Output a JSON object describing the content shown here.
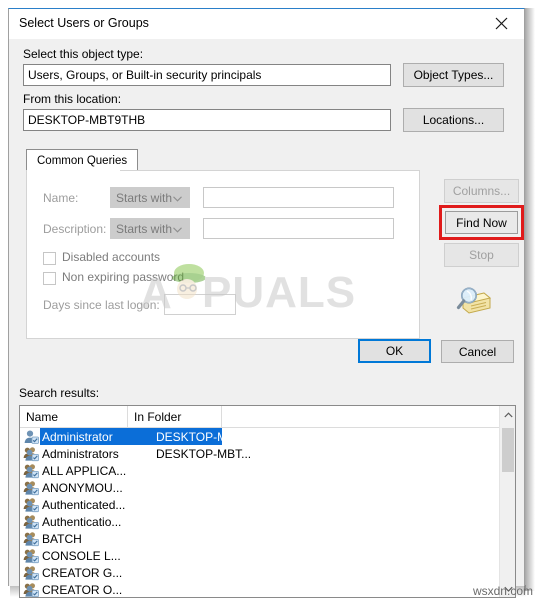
{
  "window": {
    "title": "Select Users or Groups",
    "close_icon": "close-icon"
  },
  "object_type": {
    "label": "Select this object type:",
    "value": "Users, Groups, or Built-in security principals",
    "button": "Object Types..."
  },
  "location": {
    "label": "From this location:",
    "value": "DESKTOP-MBT9THB",
    "button": "Locations..."
  },
  "tabs": [
    {
      "label": "Common Queries",
      "active": true
    }
  ],
  "query": {
    "name_label": "Name:",
    "name_operator": "Starts with",
    "name_value": "",
    "description_label": "Description:",
    "description_operator": "Starts with",
    "description_value": "",
    "disabled_accounts_label": "Disabled accounts",
    "disabled_accounts_checked": false,
    "non_expiring_password_label": "Non expiring password",
    "non_expiring_password_checked": false,
    "days_since_label": "Days since last logon:",
    "days_since_value": ""
  },
  "side_buttons": {
    "columns": "Columns...",
    "find_now": "Find Now",
    "stop": "Stop",
    "find_now_highlighted": true,
    "highlight_color": "#e01b1b",
    "search_icon": "search-folder-icon"
  },
  "dialog_buttons": {
    "ok": "OK",
    "cancel": "Cancel"
  },
  "results": {
    "label": "Search results:",
    "columns": [
      "Name",
      "In Folder"
    ],
    "rows": [
      {
        "name": "Administrator",
        "folder": "DESKTOP-MBT...",
        "icon": "user-icon",
        "selected": true
      },
      {
        "name": "Administrators",
        "folder": "DESKTOP-MBT...",
        "icon": "group-icon",
        "selected": false
      },
      {
        "name": "ALL APPLICA...",
        "folder": "",
        "icon": "group-icon",
        "selected": false
      },
      {
        "name": "ANONYMOU...",
        "folder": "",
        "icon": "group-icon",
        "selected": false
      },
      {
        "name": "Authenticated...",
        "folder": "",
        "icon": "group-icon",
        "selected": false
      },
      {
        "name": "Authenticatio...",
        "folder": "",
        "icon": "group-icon",
        "selected": false
      },
      {
        "name": "BATCH",
        "folder": "",
        "icon": "group-icon",
        "selected": false
      },
      {
        "name": "CONSOLE L...",
        "folder": "",
        "icon": "group-icon",
        "selected": false
      },
      {
        "name": "CREATOR G...",
        "folder": "",
        "icon": "group-icon",
        "selected": false
      },
      {
        "name": "CREATOR O...",
        "folder": "",
        "icon": "group-icon",
        "selected": false
      }
    ]
  },
  "watermarks": {
    "center_brand_a": "A",
    "center_brand_rest": "PUALS",
    "corner": "wsxdn.com"
  },
  "colors": {
    "accent": "#0078d7",
    "selection": "#0b6ed8",
    "annotation": "#e01b1b",
    "dialog_bg": "#f0f0f0"
  }
}
